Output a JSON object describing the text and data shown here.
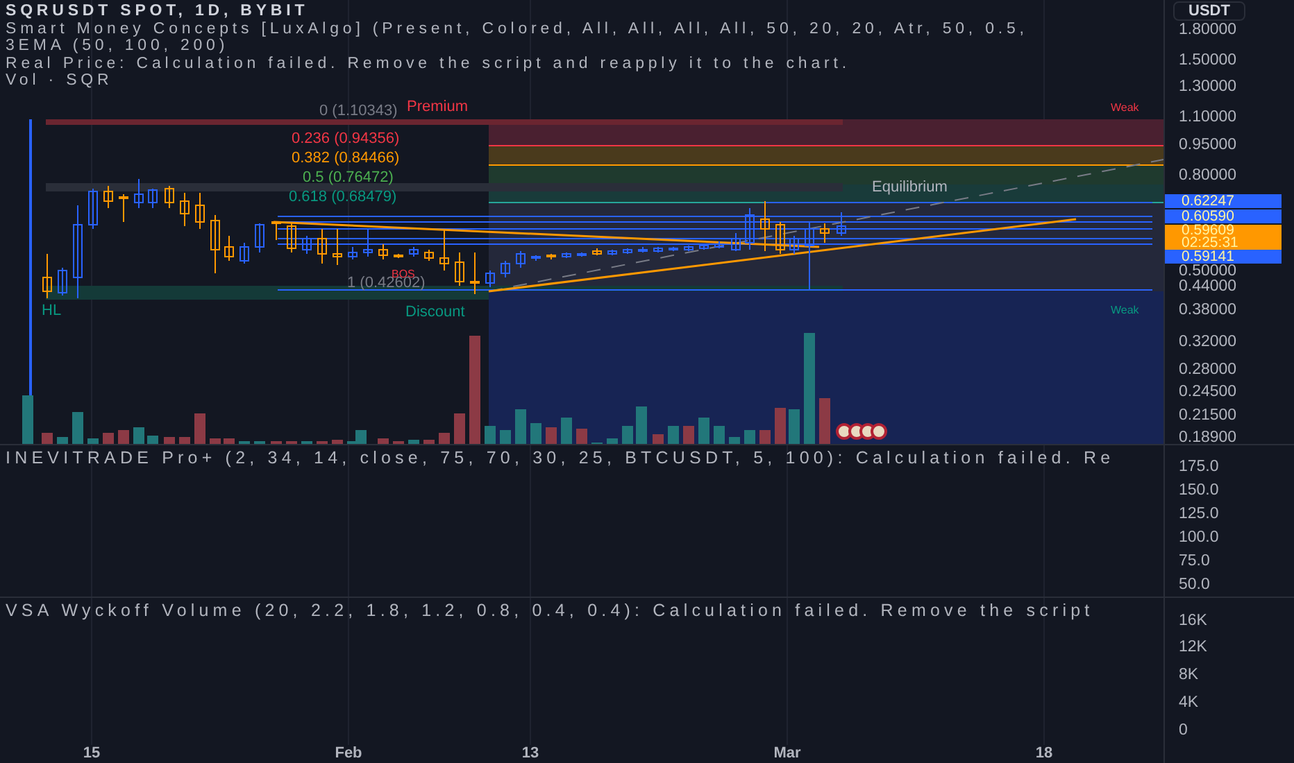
{
  "header": {
    "symbol": "SQRUSDT SPOT, 1D, BYBIT",
    "indicators": [
      "Smart Money Concepts [LuxAlgo] (Present, Colored, All, All, All, All, 50, 20, 20, Atr, 50, 0.5,",
      "3EMA (50, 100, 200)",
      "Real Price: Calculation failed. Remove the script and reapply it to the chart.",
      "Vol · SQR"
    ]
  },
  "currency": "USDT",
  "price_axis": [
    "1.80000",
    "1.50000",
    "1.30000",
    "1.10000",
    "0.95000",
    "0.80000",
    "0.50000",
    "0.44000",
    "0.38000",
    "0.32000",
    "0.28000",
    "0.24500",
    "0.21500",
    "0.18900"
  ],
  "price_tags": [
    {
      "value": "0.62247",
      "color": "#2962ff"
    },
    {
      "value": "0.60590",
      "color": "#2962ff"
    },
    {
      "value": "0.59609",
      "countdown": "02:25:31",
      "color": "#ff9800"
    },
    {
      "value": "0.59141",
      "color": "#2962ff"
    }
  ],
  "fib_levels": [
    {
      "text": "0 (1.10343)",
      "color": "#787b86"
    },
    {
      "text": "0.236 (0.94356)",
      "color": "#f23645"
    },
    {
      "text": "0.382 (0.84466)",
      "color": "#ff9800"
    },
    {
      "text": "0.5 (0.76472)",
      "color": "#4caf50"
    },
    {
      "text": "0.618 (0.68479)",
      "color": "#089981"
    },
    {
      "text": "1 (0.42602)",
      "color": "#787b86"
    }
  ],
  "zone_labels": [
    {
      "text": "Premium",
      "color": "#f23645"
    },
    {
      "text": "Weak",
      "color": "#f23645"
    },
    {
      "text": "Equilibrium",
      "color": "#b2b5be"
    },
    {
      "text": "BOS",
      "color": "#f23645"
    },
    {
      "text": "HL",
      "color": "#089981"
    },
    {
      "text": "Discount",
      "color": "#089981"
    },
    {
      "text": "Weak",
      "color": "#089981"
    }
  ],
  "oscillator_pane": {
    "legend": "INEVITRADE Pro+ (2, 34, 14, close, 75, 70, 30, 25, BTCUSDT, 5, 100): Calculation failed. Re",
    "axis": [
      "175.0",
      "150.0",
      "125.0",
      "100.0",
      "75.0",
      "50.0"
    ]
  },
  "volume_pane": {
    "legend": "VSA Wyckoff Volume (20, 2.2, 1.8, 1.2, 0.8, 0.4, 0.4): Calculation failed. Remove the script",
    "axis": [
      "16K",
      "12K",
      "8K",
      "4K",
      "0"
    ]
  },
  "time_axis": [
    "15",
    "Feb",
    "13",
    "Mar",
    "18"
  ]
}
